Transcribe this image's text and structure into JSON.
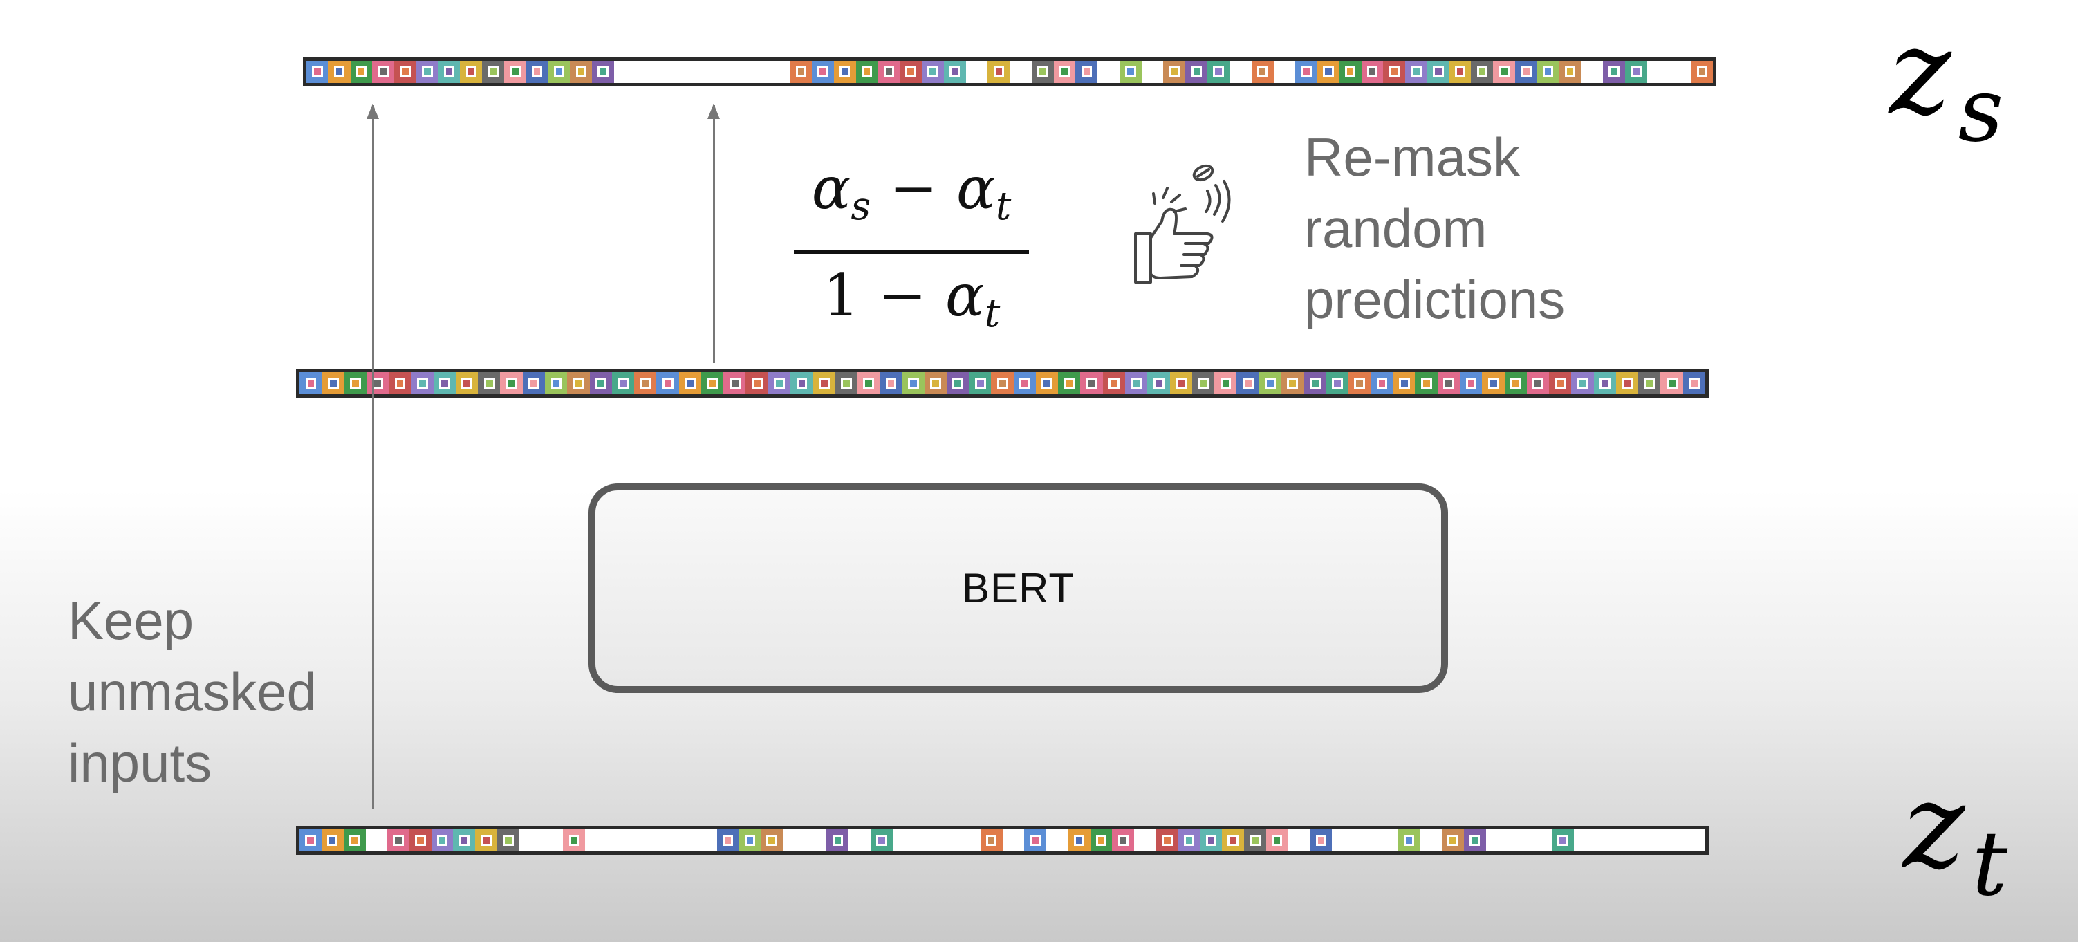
{
  "labels": {
    "zs_base": "z",
    "zs_sub": "s",
    "zt_base": "z",
    "zt_sub": "t"
  },
  "formula": {
    "num_a": "α",
    "num_a_sub": "s",
    "num_minus": " − ",
    "num_b": "α",
    "num_b_sub": "t",
    "den_one": "1 − ",
    "den_b": "α",
    "den_b_sub": "t"
  },
  "remask_note": [
    "Re-mask",
    "random",
    "predictions"
  ],
  "keep_note": [
    "Keep",
    "unmasked",
    "inputs"
  ],
  "model": {
    "name": "BERT"
  },
  "icons": {
    "coin_flip": "coin-flip-icon"
  },
  "colors": {
    "strip_border": "#2a2a2a",
    "arrow": "#777777",
    "text_gray": "#6b6b6b",
    "bert_border": "#5a5a5a",
    "palette": [
      "#5b8ed6",
      "#e59c37",
      "#3f9a4c",
      "#e06a8c",
      "#c55252",
      "#8f7cc9",
      "#5fb7b0",
      "#d8b33c",
      "#6a6a6a",
      "#f09aa0",
      "#4d6fb8",
      "#9ac45c",
      "#c98a55",
      "#7e5ea8",
      "#48a88a",
      "#e07b4a"
    ]
  },
  "token_rows": {
    "zs": "ABCDEFGHIJKLMN........PQRSTUVW.X.YZa.b.cde.f.ghijklmnopqrs.tu..v",
    "intermediate": "ABCDEFGHIJKLMNOPQRSTUVWXYZabcdefghijklmnopqrstuvwxyzABCDEFGHIJK",
    "zt": "ABC.DEFGHI..J......KLM..N.O....P.Q.RST.UVWXYZ.a...b.cd...e",
    "zt_length": 64
  }
}
